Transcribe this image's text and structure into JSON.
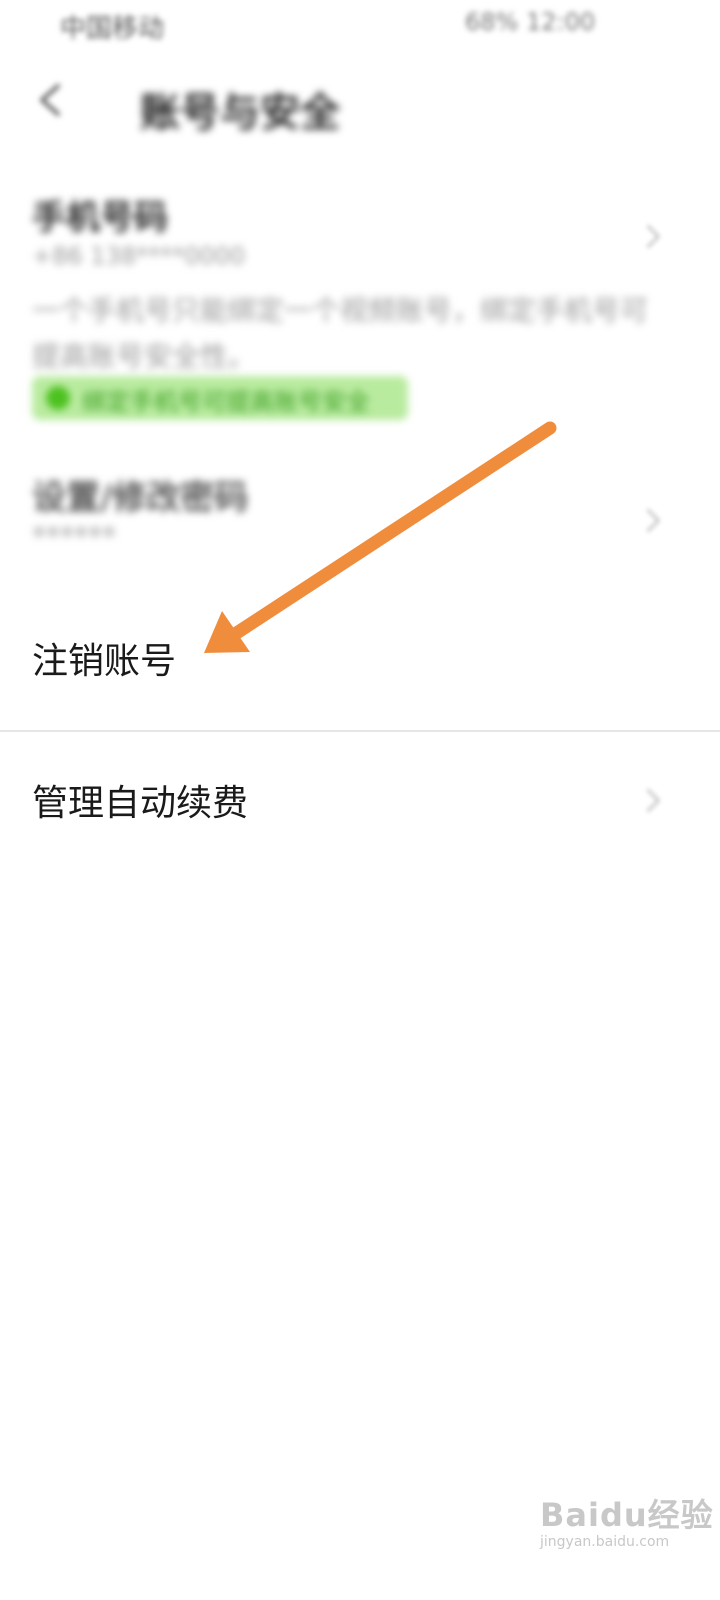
{
  "status_bar": {
    "left_text": "中国移动",
    "right_text": "68%  12:00"
  },
  "header": {
    "back_icon": "back-arrow-icon",
    "title": "账号与安全"
  },
  "phone_section": {
    "title": "手机号码",
    "number": "+86 138****0000",
    "description": "一个手机号只能绑定一个视频账号，绑定手机号可提高账号安全性。",
    "badge": "绑定手机号可提高账号安全"
  },
  "password_section": {
    "title": "设置/修改密码",
    "value": "******"
  },
  "rows": {
    "cancel_account": "注销账号",
    "manage_renewal": "管理自动续费"
  },
  "annotation": {
    "arrow_color": "#f08d3c"
  },
  "watermark": {
    "brand": "Baidu经验",
    "url": "jingyan.baidu.com"
  },
  "colors": {
    "background": "#ffffff",
    "divider": "#e6e6e6",
    "green_badge": "#b9eb9f"
  }
}
